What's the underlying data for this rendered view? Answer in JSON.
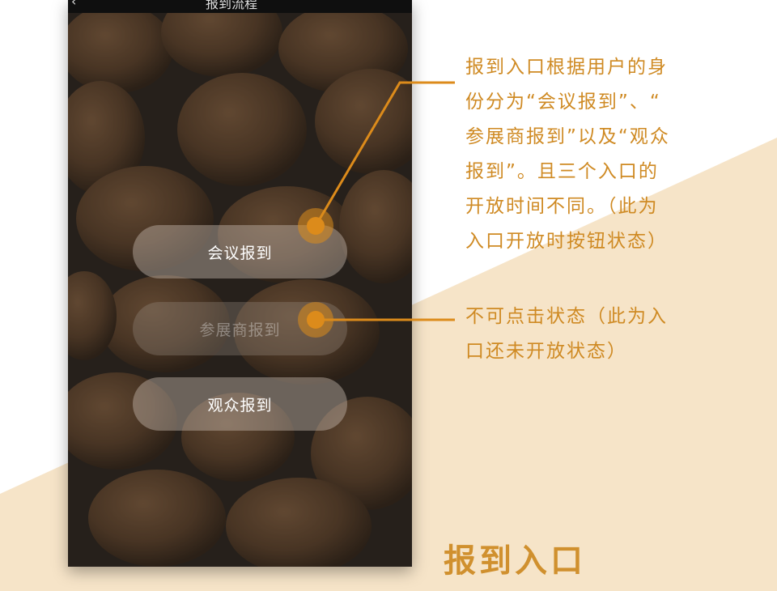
{
  "screen": {
    "status_title": "报到流程",
    "back_symbol": "‹"
  },
  "buttons": {
    "conference": {
      "label": "会议报到",
      "enabled": true
    },
    "exhibitor": {
      "label": "参展商报到",
      "enabled": false
    },
    "audience": {
      "label": "观众报到",
      "enabled": true
    }
  },
  "annotations": {
    "open_note": [
      "报到入口根据用户的身",
      "份分为“会议报到”、“",
      "参展商报到”以及“观众",
      "报到”。且三个入口的",
      "开放时间不同。（此为",
      "入口开放时按钮状态）"
    ],
    "disabled_note": [
      "不可点击状态（此为入",
      "口还未开放状态）"
    ]
  },
  "page_heading": "报到入口",
  "colors": {
    "accent": "#dc8b1b",
    "annotation_text": "#cf8a23",
    "beige_background": "#f6e4c8"
  }
}
